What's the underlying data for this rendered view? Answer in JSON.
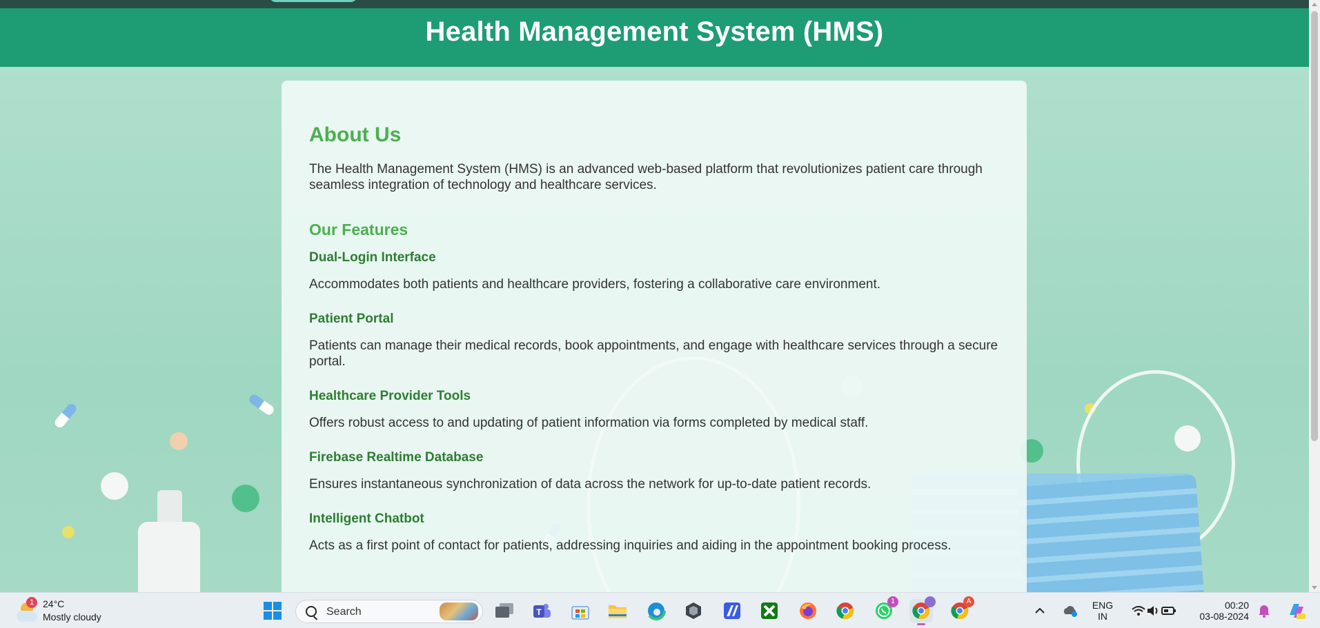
{
  "header": {
    "title": "Health Management System (HMS)"
  },
  "about": {
    "heading": "About Us",
    "intro": "The Health Management System (HMS) is an advanced web-based platform that revolutionizes patient care through seamless integration of technology and healthcare services.",
    "features_heading": "Our Features",
    "features": [
      {
        "title": "Dual-Login Interface",
        "description": "Accommodates both patients and healthcare providers, fostering a collaborative care environment."
      },
      {
        "title": "Patient Portal",
        "description": "Patients can manage their medical records, book appointments, and engage with healthcare services through a secure portal."
      },
      {
        "title": "Healthcare Provider Tools",
        "description": "Offers robust access to and updating of patient information via forms completed by medical staff."
      },
      {
        "title": "Firebase Realtime Database",
        "description": "Ensures instantaneous synchronization of data across the network for up-to-date patient records."
      },
      {
        "title": "Intelligent Chatbot",
        "description": "Acts as a first point of contact for patients, addressing inquiries and aiding in the appointment booking process."
      }
    ]
  },
  "taskbar": {
    "weather": {
      "badge": "1",
      "temperature": "24°C",
      "condition": "Mostly cloudy"
    },
    "search_label": "Search",
    "apps": [
      {
        "name": "start-button",
        "icon": "windows-logo-icon"
      },
      {
        "name": "task-view",
        "icon": "task-view-icon"
      },
      {
        "name": "teams",
        "icon": "teams-icon"
      },
      {
        "name": "microsoft-store",
        "icon": "store-icon"
      },
      {
        "name": "file-explorer",
        "icon": "folder-icon"
      },
      {
        "name": "edge",
        "icon": "edge-icon"
      },
      {
        "name": "app-cube",
        "icon": "cube-icon"
      },
      {
        "name": "ai-app",
        "icon": "ai-icon"
      },
      {
        "name": "xbox",
        "icon": "xbox-icon"
      },
      {
        "name": "firefox",
        "icon": "firefox-icon"
      },
      {
        "name": "chrome",
        "icon": "chrome-icon"
      },
      {
        "name": "whatsapp",
        "icon": "whatsapp-icon",
        "badge": "1"
      },
      {
        "name": "chrome-profile-active",
        "icon": "chrome-icon"
      },
      {
        "name": "chrome-profile-a",
        "icon": "chrome-icon",
        "badge": "A"
      }
    ],
    "tray": {
      "language_line1": "ENG",
      "language_line2": "IN",
      "time": "00:20",
      "date": "03-08-2024"
    }
  },
  "colors": {
    "header_bg": "#1e9c73",
    "heading_green": "#4caf50",
    "feature_title_green": "#2e7d32"
  }
}
